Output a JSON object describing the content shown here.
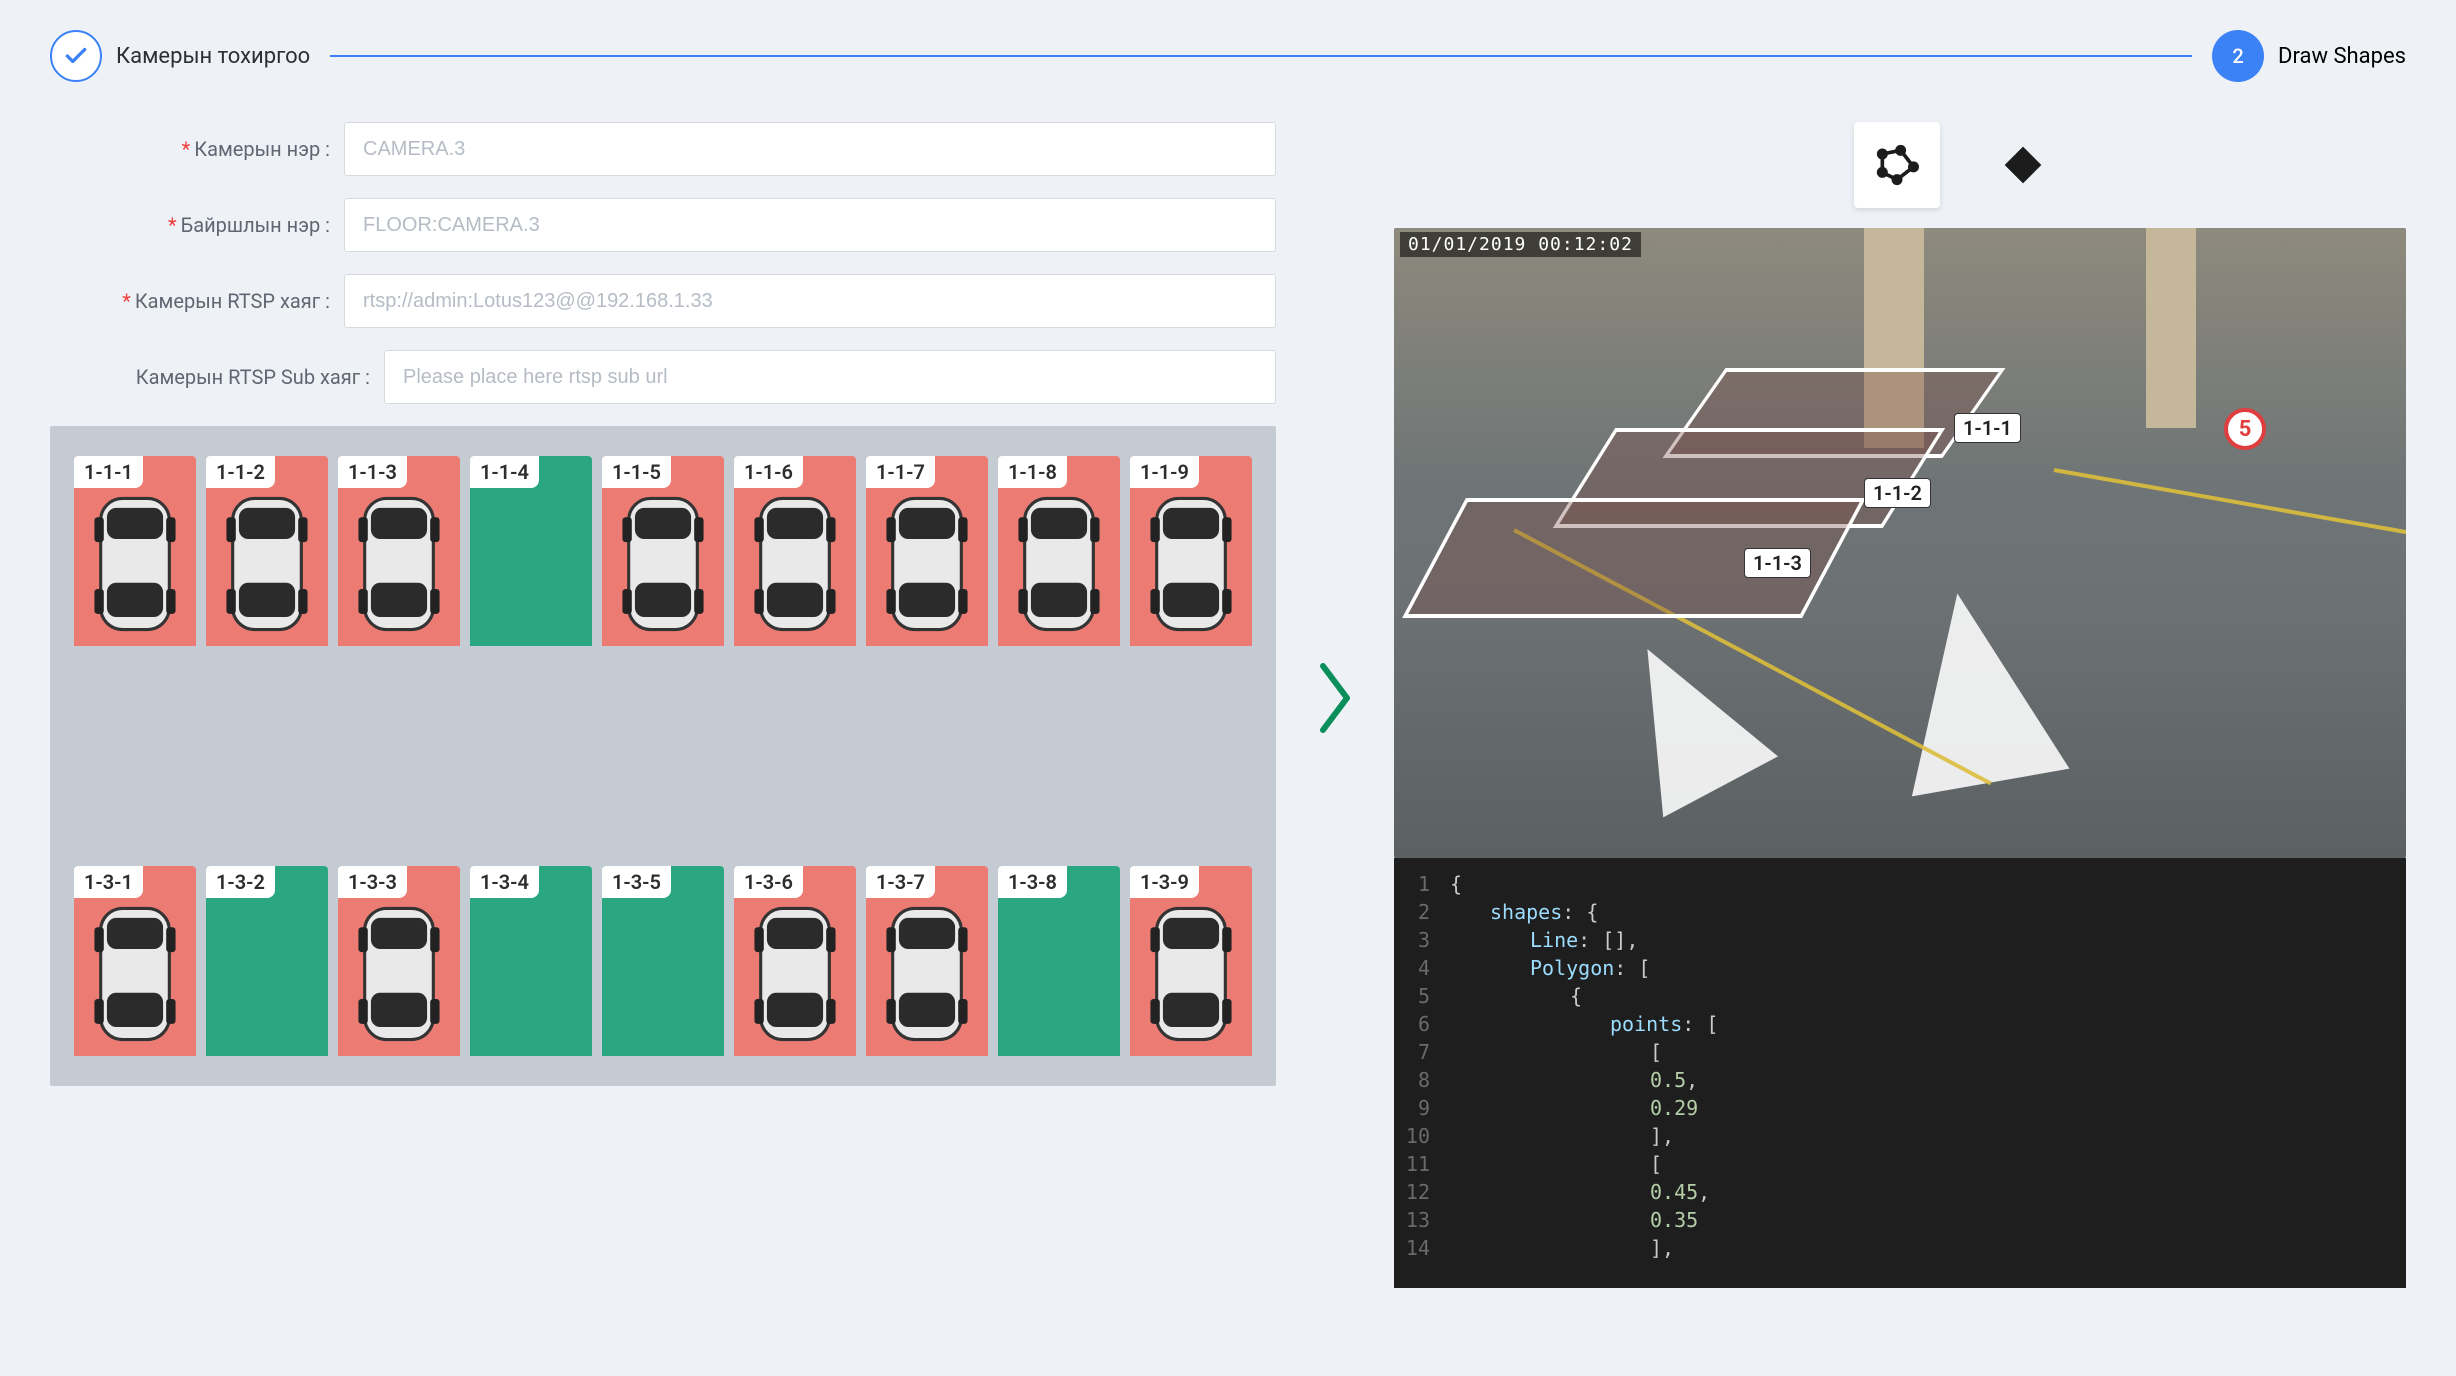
{
  "stepper": {
    "step1_title": "Камерын тохиргоо",
    "step2_num": "2",
    "step2_title": "Draw Shapes"
  },
  "form": {
    "camera_name_label": "Камерын нэр :",
    "camera_name_value": "CAMERA.3",
    "location_name_label": "Байршлын нэр :",
    "location_name_value": "FLOOR:CAMERA.3",
    "rtsp_label": "Камерын RTSP хаяг :",
    "rtsp_value": "rtsp://admin:Lotus123@@192.168.1.33",
    "rtsp_sub_label": "Камерын RTSP Sub хаяг :",
    "rtsp_sub_placeholder": "Please place here rtsp sub url"
  },
  "parking": {
    "row1": [
      {
        "label": "1-1-1",
        "status": "occupied"
      },
      {
        "label": "1-1-2",
        "status": "occupied"
      },
      {
        "label": "1-1-3",
        "status": "occupied"
      },
      {
        "label": "1-1-4",
        "status": "free"
      },
      {
        "label": "1-1-5",
        "status": "occupied"
      },
      {
        "label": "1-1-6",
        "status": "occupied"
      },
      {
        "label": "1-1-7",
        "status": "occupied"
      },
      {
        "label": "1-1-8",
        "status": "occupied"
      },
      {
        "label": "1-1-9",
        "status": "occupied"
      }
    ],
    "row2": [
      {
        "label": "1-3-1",
        "status": "occupied"
      },
      {
        "label": "1-3-2",
        "status": "free"
      },
      {
        "label": "1-3-3",
        "status": "occupied"
      },
      {
        "label": "1-3-4",
        "status": "free"
      },
      {
        "label": "1-3-5",
        "status": "free"
      },
      {
        "label": "1-3-6",
        "status": "occupied"
      },
      {
        "label": "1-3-7",
        "status": "occupied"
      },
      {
        "label": "1-3-8",
        "status": "free"
      },
      {
        "label": "1-3-9",
        "status": "occupied"
      }
    ]
  },
  "tools": {
    "polygon": "polygon-tool",
    "eraser": "eraser-tool"
  },
  "camera_view": {
    "timestamp": "01/01/2019 00:12:02",
    "sign_number": "5",
    "roi_tags": [
      "1-1-1",
      "1-1-2",
      "1-1-3"
    ]
  },
  "code": {
    "lines": [
      {
        "n": "1",
        "indent": 0,
        "text": "{"
      },
      {
        "n": "2",
        "indent": 1,
        "text": "shapes: {"
      },
      {
        "n": "3",
        "indent": 2,
        "text": "Line: [],"
      },
      {
        "n": "4",
        "indent": 2,
        "text": "Polygon: ["
      },
      {
        "n": "5",
        "indent": 3,
        "text": "{"
      },
      {
        "n": "6",
        "indent": 4,
        "text": "points: ["
      },
      {
        "n": "7",
        "indent": 5,
        "text": "["
      },
      {
        "n": "8",
        "indent": 5,
        "text": "  0.5,"
      },
      {
        "n": "9",
        "indent": 5,
        "text": "  0.29"
      },
      {
        "n": "10",
        "indent": 5,
        "text": "],"
      },
      {
        "n": "11",
        "indent": 5,
        "text": "["
      },
      {
        "n": "12",
        "indent": 5,
        "text": "  0.45,"
      },
      {
        "n": "13",
        "indent": 5,
        "text": "  0.35"
      },
      {
        "n": "14",
        "indent": 5,
        "text": "],"
      }
    ]
  }
}
